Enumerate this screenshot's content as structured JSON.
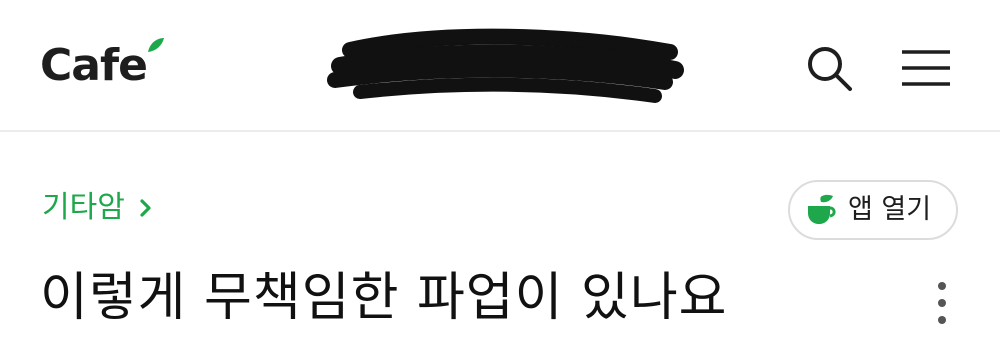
{
  "header": {
    "logo_text": "Cafe",
    "cafe_name_redacted": true,
    "search_icon": "search-icon",
    "menu_icon": "hamburger-menu-icon"
  },
  "post": {
    "board_name": "기타암",
    "board_chevron_icon": "chevron-right-icon",
    "open_app_label": "앱 열기",
    "open_app_icon": "cafe-cup-icon",
    "title": "이렇게 무책임한 파업이 있나요",
    "more_icon": "more-vertical-icon"
  },
  "colors": {
    "brand_green": "#1fa84b",
    "text_dark": "#1e1e1e",
    "divider": "#ececec"
  }
}
